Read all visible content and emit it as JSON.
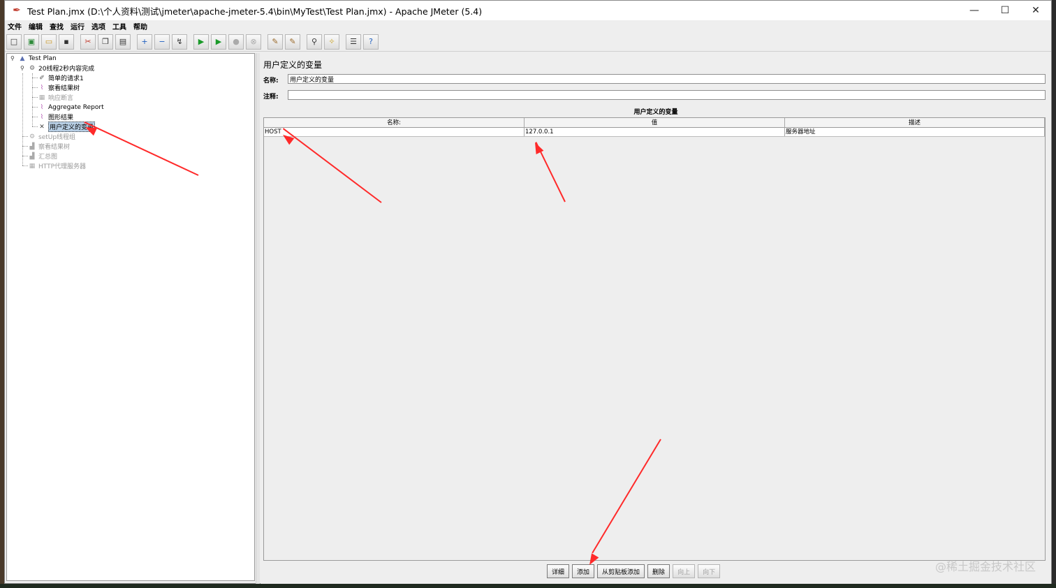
{
  "window": {
    "title": "Test Plan.jmx (D:\\个人资料\\测试\\jmeter\\apache-jmeter-5.4\\bin\\MyTest\\Test Plan.jmx) - Apache JMeter (5.4)",
    "minimize": "—",
    "maximize": "☐",
    "close": "✕"
  },
  "menu": [
    "文件",
    "编辑",
    "查找",
    "运行",
    "选项",
    "工具",
    "帮助"
  ],
  "tree": {
    "test_plan": "Test Plan",
    "thread_group": "20线程2秒内容完成",
    "children": [
      "简单的请求1",
      "察看结果树",
      "响应断言",
      "Aggregate Report",
      "图形结果",
      "用户定义的变量"
    ],
    "setup_group": "setUp线程组",
    "view_results": "察看结果树",
    "summary": "汇总图",
    "proxy": "HTTP代理服务器"
  },
  "main": {
    "title": "用户定义的变量",
    "name_label": "名称:",
    "name_value": "用户定义的变量",
    "comment_label": "注释:",
    "comment_value": "",
    "table_title": "用户定义的变量",
    "columns": [
      "名称:",
      "值",
      "描述"
    ],
    "rows": [
      [
        "HOST",
        "127.0.0.1",
        "服务器地址"
      ]
    ],
    "buttons": {
      "detail": "详细",
      "add": "添加",
      "add_clipboard": "从剪贴板添加",
      "delete": "删除",
      "up": "向上",
      "down": "向下"
    }
  },
  "watermark": "@稀土掘金技术社区",
  "colors": {
    "accent_arrow": "#ff2a2a",
    "selection": "#b8cfe5"
  }
}
